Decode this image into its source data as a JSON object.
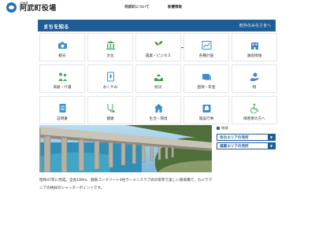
{
  "header": {
    "logo_small": "北海道",
    "logo_title": "阿武町役場",
    "nav": [
      "阿武町について",
      "影響情報"
    ]
  },
  "category_bar": {
    "title": "まちを知る",
    "link": "町外のみなさまへ"
  },
  "tiles": [
    {
      "label": "観光",
      "icon": "camera-icon",
      "color": "#3a8fd0"
    },
    {
      "label": "文化",
      "icon": "museum-icon",
      "color": "#4aa85a"
    },
    {
      "label": "農業・ビジネス",
      "icon": "plant-icon",
      "color": "#3f9a3f"
    },
    {
      "label": "各種計画",
      "icon": "chart-icon",
      "color": "#3a8fd0"
    },
    {
      "label": "議会情報",
      "icon": "building-icon",
      "color": "#4a80c8"
    },
    {
      "label": "高齢・介護",
      "icon": "care-icon",
      "color": "#4aa85a"
    },
    {
      "label": "おくやみ",
      "icon": "memorial-icon",
      "color": "#3a8fd0"
    },
    {
      "label": "防災",
      "icon": "disaster-icon",
      "color": "#3f9a3f"
    },
    {
      "label": "国保・年金",
      "icon": "card-icon",
      "color": "#3a8fd0"
    },
    {
      "label": "税",
      "icon": "tax-icon",
      "color": "#4a80c8"
    },
    {
      "label": "証明書",
      "icon": "certificate-icon",
      "color": "#3a8fd0"
    },
    {
      "label": "健康",
      "icon": "stethoscope-icon",
      "color": "#4aa85a"
    },
    {
      "label": "生活・環境",
      "icon": "home-icon",
      "color": "#3a8fd0"
    },
    {
      "label": "施設行事",
      "icon": "facility-icon",
      "color": "#3a8fd0"
    },
    {
      "label": "障害者の方へ",
      "icon": "accessibility-icon",
      "color": "#4aa85a"
    }
  ],
  "feature": {
    "photo": "railway-bridge-photo",
    "caption": "昭和47年に完成。全長189m、鉄筋コンクリート4柱ラーメンスラブ式の架年で美しい鉄道橋で、カメラマニアの格好のシャッターポイントです。"
  },
  "sidebar": {
    "heading": "地域",
    "buttons": [
      {
        "label": "奈古エリアの見所",
        "icon": "chevron-down-icon"
      },
      {
        "label": "福賀エリアの見所",
        "icon": "chevron-down-icon"
      }
    ]
  }
}
